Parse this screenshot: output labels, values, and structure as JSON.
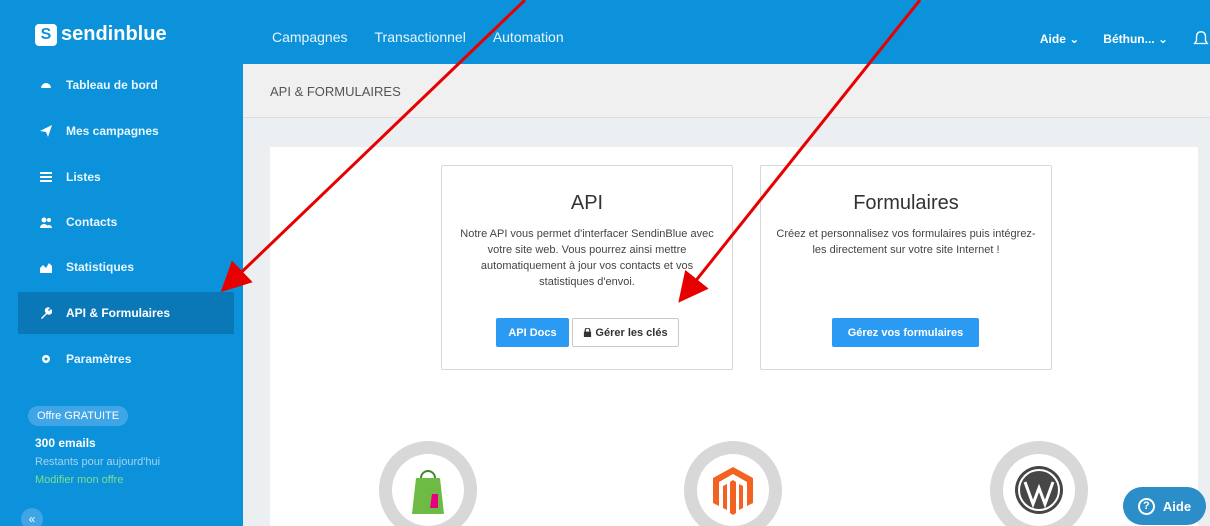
{
  "brand": {
    "name": "sendinblue"
  },
  "topnav": {
    "items": [
      "Campagnes",
      "Transactionnel",
      "Automation"
    ]
  },
  "topright": {
    "help": "Aide ⌄",
    "account": "Béthun... ⌄"
  },
  "sidebar": {
    "items": [
      {
        "label": "Tableau de bord",
        "icon": "dashboard-icon"
      },
      {
        "label": "Mes campagnes",
        "icon": "paper-plane-icon"
      },
      {
        "label": "Listes",
        "icon": "list-icon"
      },
      {
        "label": "Contacts",
        "icon": "users-icon"
      },
      {
        "label": "Statistiques",
        "icon": "chart-icon"
      },
      {
        "label": "API & Formulaires",
        "icon": "wrench-icon",
        "active": true
      },
      {
        "label": "Paramètres",
        "icon": "gear-icon"
      }
    ],
    "offer_badge": "Offre GRATUITE",
    "offer_count": "300 emails",
    "offer_remaining": "Restants pour aujourd'hui",
    "offer_modify": "Modifier mon offre",
    "collapse_label": "«"
  },
  "header": {
    "title": "API & FORMULAIRES"
  },
  "api_box": {
    "title": "API",
    "description": "Notre API vous permet d'interfacer SendinBlue avec votre site web. Vous pourrez ainsi mettre automatiquement à jour vos contacts et vos statistiques d'envoi.",
    "docs_button": "API Docs",
    "keys_button": "Gérer les clés"
  },
  "forms_box": {
    "title": "Formulaires",
    "description": "Créez et personnalisez vos formulaires puis intégrez-les directement sur votre site Internet !",
    "button": "Gérez vos formulaires"
  },
  "plugins": [
    "prestashop-icon",
    "magento-icon",
    "wordpress-icon"
  ],
  "help_widget": {
    "label": "Aide",
    "icon_char": "?"
  },
  "colors": {
    "primary": "#0b92da",
    "active": "#0a78b7",
    "button": "#2b9af3",
    "arrow": "#e60000"
  }
}
